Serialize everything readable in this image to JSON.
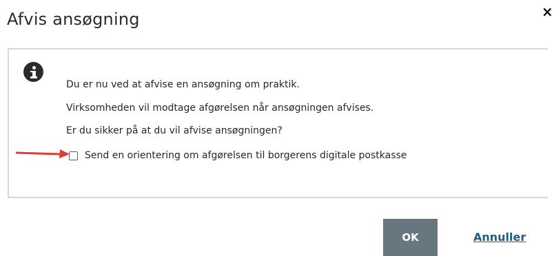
{
  "dialog": {
    "title": "Afvis ansøgning",
    "close_icon": "×"
  },
  "message": {
    "icon": "info-icon",
    "lines": [
      "Du er nu ved at afvise en ansøgning om praktik.",
      "Virksomheden vil modtage afgørelsen når ansøgningen afvises.",
      "Er du sikker på at du vil afvise ansøgningen?"
    ]
  },
  "checkbox": {
    "label": "Send en orientering om afgørelsen til borgerens digitale postkasse",
    "checked": false
  },
  "annotation": {
    "icon": "red-arrow-icon",
    "color": "#e53935"
  },
  "buttons": {
    "ok_label": "OK",
    "cancel_label": "Annuller"
  },
  "colors": {
    "ok_button": "#67767f",
    "link": "#1f5d86",
    "border": "#d7d7d7"
  }
}
